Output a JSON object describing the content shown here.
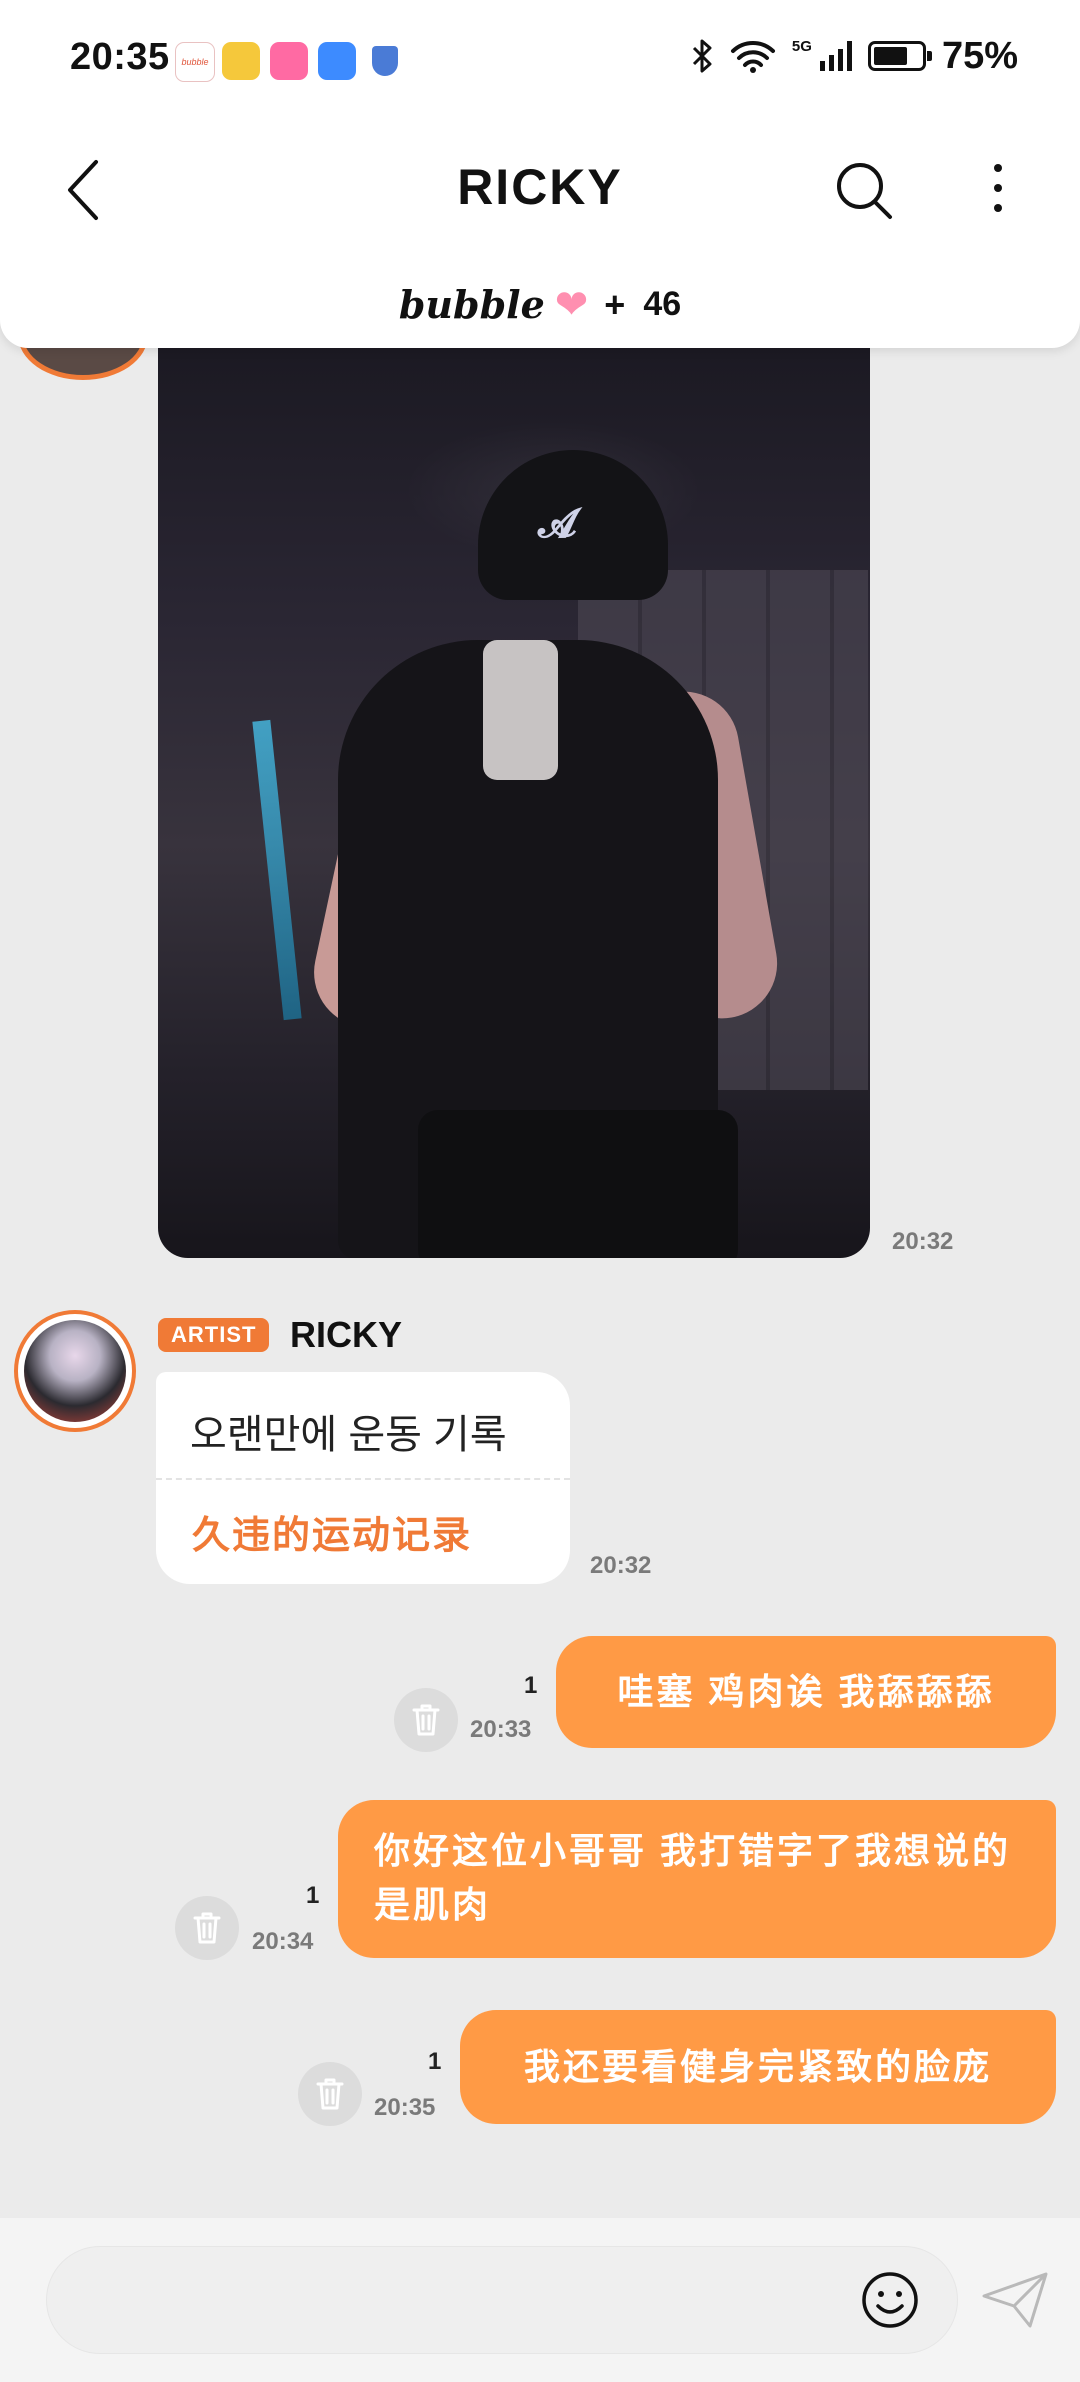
{
  "status_bar": {
    "time": "20:35",
    "network": "5G",
    "battery_percent": "75%",
    "battery_level": 0.75,
    "notification_icons": [
      "bubble-app-icon",
      "weibo-icon",
      "bilibili-icon",
      "message-icon",
      "shield-icon"
    ]
  },
  "header": {
    "title": "RICKY",
    "bubble_logo": "bubble",
    "bubble_plus": "+",
    "bubble_count": "46"
  },
  "chat": {
    "image_message": {
      "time": "20:32"
    },
    "artist_message": {
      "badge": "ARTIST",
      "name": "RICKY",
      "text_ko": "오랜만에 운동 기록",
      "text_zh": "久违的运动记录",
      "time": "20:32"
    },
    "my_messages": [
      {
        "text": "哇塞 鸡肉诶 我舔舔舔",
        "count": "1",
        "time": "20:33"
      },
      {
        "text": "你好这位小哥哥 我打错字了我想说的是肌肉",
        "count": "1",
        "time": "20:34"
      },
      {
        "text": "我还要看健身完紧致的脸庞",
        "count": "1",
        "time": "20:35"
      }
    ]
  },
  "input": {
    "placeholder": ""
  },
  "colors": {
    "accent": "#f07a36",
    "my_bubble": "#ff9a45",
    "background": "#ebebeb"
  }
}
